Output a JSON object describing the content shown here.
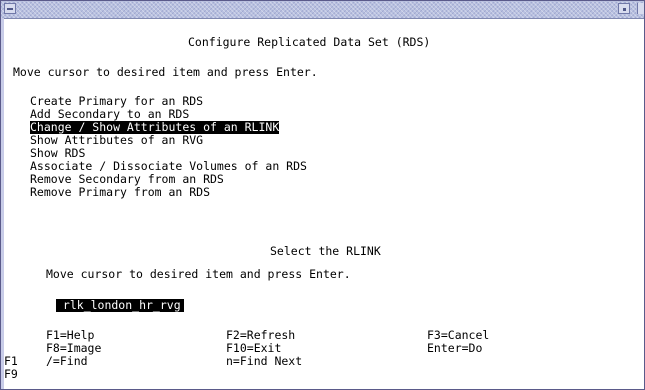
{
  "window": {
    "title": ""
  },
  "smit": {
    "menu_title": "Configure Replicated Data Set (RDS)",
    "instruction": "Move cursor to desired item and press Enter.",
    "menu_items": [
      "Create Primary for an RDS",
      "Add Secondary to an RDS",
      "Change / Show Attributes of an RLINK",
      "Show Attributes of an RVG",
      "Show RDS",
      "Associate / Dissociate Volumes of an RDS",
      "Remove Secondary from an RDS",
      "Remove Primary from an RDS"
    ],
    "selected_menu_index": 2
  },
  "popup": {
    "title": "Select the RLINK",
    "instruction": "Move cursor to desired item and press Enter.",
    "selected_item": " rlk_london_hr_rvg",
    "function_keys": [
      {
        "key": "F1=Help"
      },
      {
        "key": "F2=Refresh"
      },
      {
        "key": "F3=Cancel"
      },
      {
        "key": "F8=Image"
      },
      {
        "key": "F10=Exit"
      },
      {
        "key": "Enter=Do"
      },
      {
        "key": "/=Find"
      },
      {
        "key": "n=Find Next"
      }
    ]
  },
  "background_keys": [
    "F1",
    "F9"
  ],
  "colors": {
    "selection_bg": "#000000",
    "selection_fg": "#ffffff",
    "titlebar": "#b8c0e0"
  }
}
